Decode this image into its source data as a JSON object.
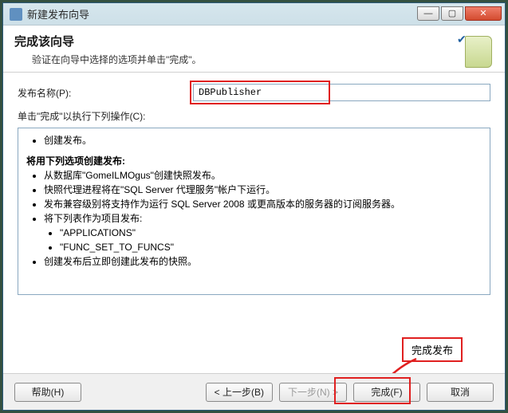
{
  "window": {
    "title": "新建发布向导",
    "minimize": "—",
    "maximize": "▢",
    "close": "✕"
  },
  "header": {
    "title": "完成该向导",
    "subtitle": "验证在向导中选择的选项并单击\"完成\"。"
  },
  "labels": {
    "publish_name": "发布名称(P):",
    "click_finish_to": "单击\"完成\"以执行下列操作(C):"
  },
  "fields": {
    "publish_name_value": "DBPublisher"
  },
  "summary": {
    "item_create": "创建发布。",
    "heading_options": "将用下列选项创建发布:",
    "opt1": "从数据库\"GomeILMOgus\"创建快照发布。",
    "opt2": "快照代理进程将在\"SQL Server 代理服务\"帐户下运行。",
    "opt3": "发布兼容级别将支持作为运行 SQL Server 2008 或更高版本的服务器的订阅服务器。",
    "opt4": "将下列表作为项目发布:",
    "sub_a": "\"APPLICATIONS\"",
    "sub_b": "\"FUNC_SET_TO_FUNCS\"",
    "opt5": "创建发布后立即创建此发布的快照。"
  },
  "annotation": {
    "finish_publish": "完成发布"
  },
  "buttons": {
    "help": "帮助(H)",
    "back": "< 上一步(B)",
    "next": "下一步(N) >",
    "finish": "完成(F)",
    "cancel": "取消"
  },
  "colors": {
    "highlight_red": "#e02020"
  }
}
